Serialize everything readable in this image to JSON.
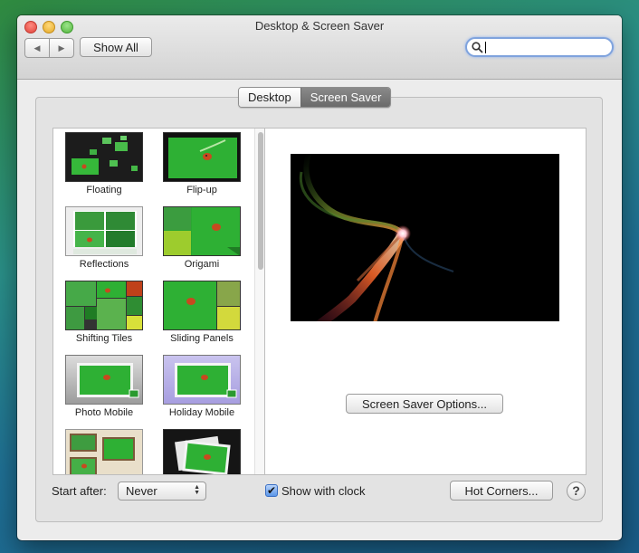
{
  "window": {
    "title": "Desktop & Screen Saver",
    "show_all_label": "Show All",
    "search": {
      "value": "",
      "placeholder": ""
    }
  },
  "tabs": [
    {
      "label": "Desktop",
      "selected": false
    },
    {
      "label": "Screen Saver",
      "selected": true
    }
  ],
  "screensavers": [
    {
      "label": "Floating"
    },
    {
      "label": "Flip-up"
    },
    {
      "label": "Reflections"
    },
    {
      "label": "Origami"
    },
    {
      "label": "Shifting Tiles"
    },
    {
      "label": "Sliding Panels"
    },
    {
      "label": "Photo Mobile"
    },
    {
      "label": "Holiday Mobile"
    },
    {
      "label": ""
    },
    {
      "label": ""
    }
  ],
  "options_button_label": "Screen Saver Options...",
  "footer": {
    "start_after_label": "Start after:",
    "start_after_value": "Never",
    "show_clock_label": "Show with clock",
    "show_clock_checked": true,
    "hot_corners_label": "Hot Corners...",
    "help_label": "?"
  },
  "colors": {
    "accent_selected_tab": "#777777",
    "thumb_green": "#2fb52f",
    "focus_ring": "#7fa3dd"
  }
}
